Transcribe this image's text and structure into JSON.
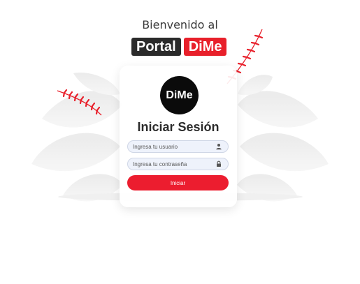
{
  "header": {
    "welcome_text": "Bienvenido al",
    "brand_left": "Portal",
    "brand_right": "DiMe"
  },
  "login": {
    "logo_text": "DiMe",
    "title": "Iniciar Sesión",
    "username_placeholder": "Ingresa tu usuario",
    "password_placeholder": "Ingresa tu contraseña",
    "submit_label": "Iniciar"
  },
  "icons": {
    "username": "user-icon",
    "password": "lock-icon"
  },
  "colors": {
    "accent": "#ec1d2f",
    "brand_dark": "#2b2b2b",
    "input_bg": "#eef2fb"
  }
}
